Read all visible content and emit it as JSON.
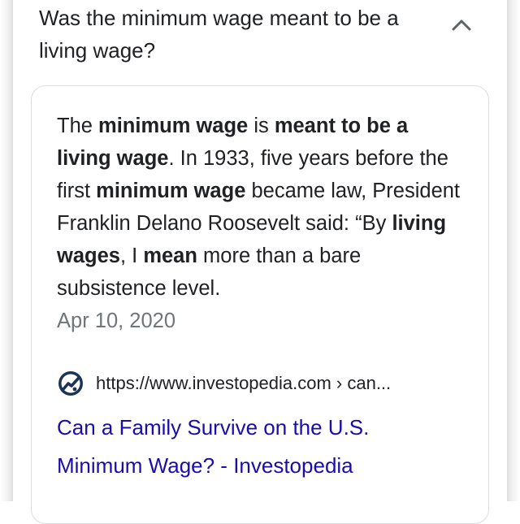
{
  "question": "Was the minimum wage meant to be a living wage?",
  "answer": {
    "segments": [
      {
        "text": "The ",
        "bold": false
      },
      {
        "text": "minimum wage",
        "bold": true
      },
      {
        "text": " is ",
        "bold": false
      },
      {
        "text": "meant to be a living wage",
        "bold": true
      },
      {
        "text": ". In 1933, five years before the first ",
        "bold": false
      },
      {
        "text": "minimum wage",
        "bold": true
      },
      {
        "text": " became law, President Franklin Delano Roosevelt said: “By ",
        "bold": false
      },
      {
        "text": "living wages",
        "bold": true
      },
      {
        "text": ", I ",
        "bold": false
      },
      {
        "text": "mean",
        "bold": true
      },
      {
        "text": " more than a bare subsistence level.",
        "bold": false
      }
    ],
    "date": "Apr 10, 2020"
  },
  "source": {
    "url": "https://www.investopedia.com › can...",
    "favicon_icon": "investopedia-logo-icon"
  },
  "result_title": "Can a Family Survive on the U.S. Minimum Wage? - Investopedia",
  "colors": {
    "text": "#202124",
    "date": "#70757a",
    "link": "#1a0dab",
    "card_border": "#dadce0",
    "favicon": "#1f3358"
  }
}
